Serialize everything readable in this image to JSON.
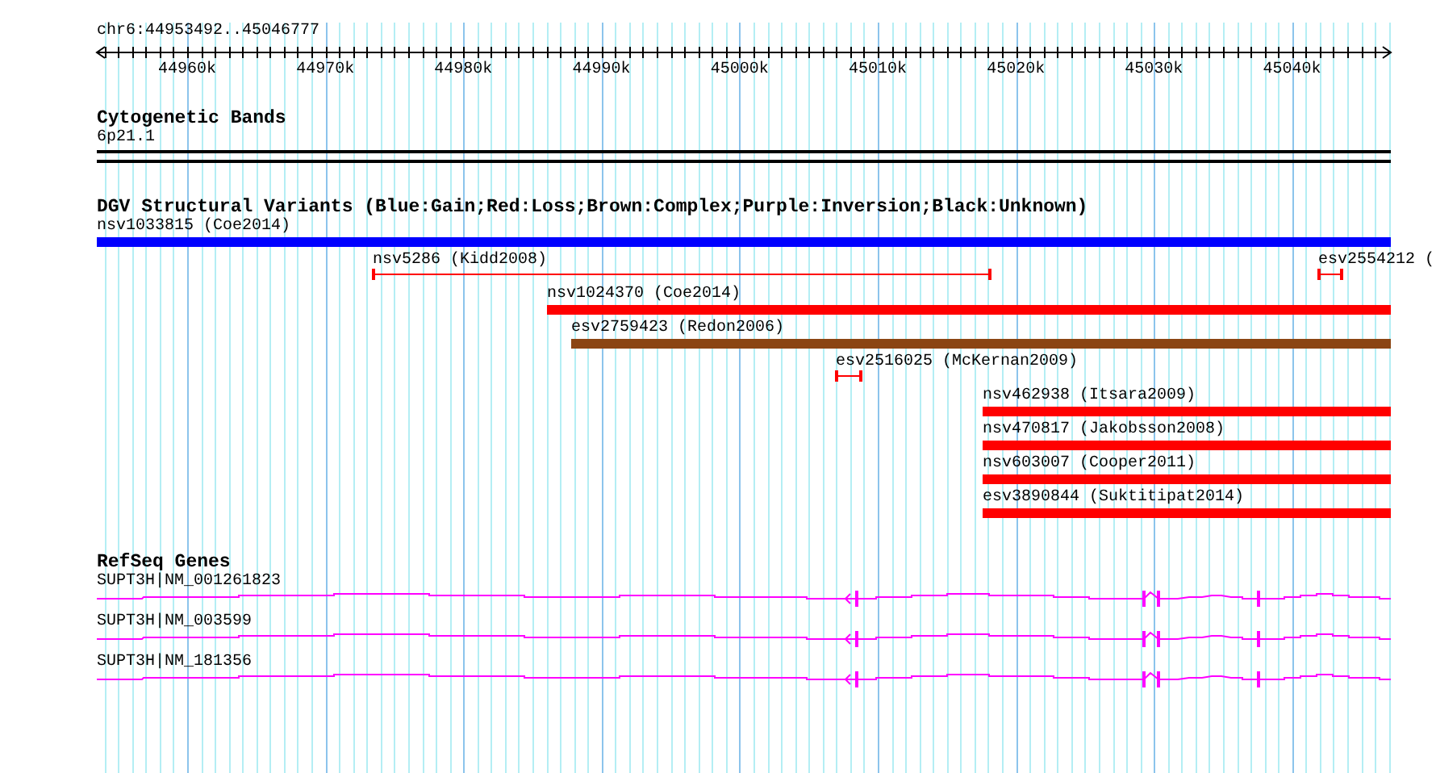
{
  "ruler": {
    "title": "chr6:44953492..45046777",
    "tick_labels": [
      "44960k",
      "44970k",
      "44980k",
      "44990k",
      "45000k",
      "45010k",
      "45020k",
      "45030k",
      "45040k"
    ]
  },
  "tracks": [
    {
      "kind": "bands",
      "title": "Cytogenetic Bands",
      "features": [
        {
          "label": "6p21.1"
        }
      ]
    },
    {
      "kind": "variants",
      "title": "DGV Structural Variants (Blue:Gain;Red:Loss;Brown:Complex;Purple:Inversion;Black:Unknown)",
      "rows": [
        {
          "features": [
            {
              "label": "nsv1033815 (Coe2014)",
              "kind": "bar",
              "color": "#0000ff"
            }
          ]
        },
        {
          "features": [
            {
              "label": "nsv5286 (Kidd2008)",
              "kind": "span",
              "color": "#ff0000"
            },
            {
              "label": "esv2554212 (",
              "kind": "span",
              "color": "#ff0000"
            }
          ]
        },
        {
          "features": [
            {
              "label": "nsv1024370 (Coe2014)",
              "kind": "bar",
              "color": "#ff0000"
            }
          ]
        },
        {
          "features": [
            {
              "label": "esv2759423 (Redon2006)",
              "kind": "bar",
              "color": "#8b4513"
            }
          ]
        },
        {
          "features": [
            {
              "label": "esv2516025 (McKernan2009)",
              "kind": "span",
              "color": "#ff0000"
            }
          ]
        },
        {
          "features": [
            {
              "label": "nsv462938 (Itsara2009)",
              "kind": "bar",
              "color": "#ff0000"
            }
          ]
        },
        {
          "features": [
            {
              "label": "nsv470817 (Jakobsson2008)",
              "kind": "bar",
              "color": "#ff0000"
            }
          ]
        },
        {
          "features": [
            {
              "label": "nsv603007 (Cooper2011)",
              "kind": "bar",
              "color": "#ff0000"
            }
          ]
        },
        {
          "features": [
            {
              "label": "esv3890844 (Suktitipat2014)",
              "kind": "bar",
              "color": "#ff0000"
            }
          ]
        }
      ]
    },
    {
      "kind": "genes",
      "title": "RefSeq Genes",
      "features": [
        {
          "label": "SUPT3H|NM_001261823"
        },
        {
          "label": "SUPT3H|NM_003599"
        },
        {
          "label": "SUPT3H|NM_181356"
        }
      ]
    }
  ]
}
